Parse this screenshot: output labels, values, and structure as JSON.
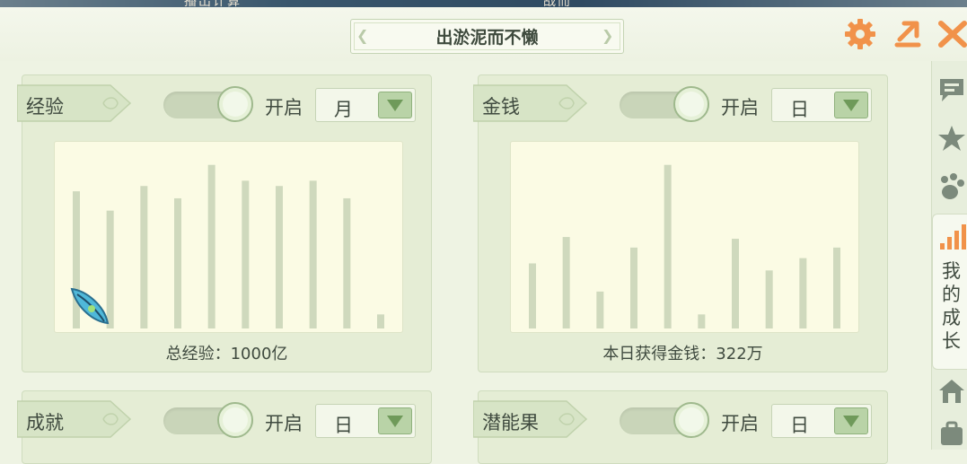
{
  "top_strip": {
    "left_text": "播出计算",
    "right_text": "战而"
  },
  "header": {
    "title": "出淤泥而不懒"
  },
  "header_icons": {
    "settings": "gear-icon",
    "export": "share-arrow-icon",
    "close": "close-icon"
  },
  "colors": {
    "accent_orange": "#f1924a",
    "bar": "#cfd9bd",
    "chart_bg": "#fbfbe4",
    "panel": "#e5edd5"
  },
  "panels": [
    {
      "label": "经验",
      "toggle_label": "开启",
      "select_value": "月",
      "total_text": "总经验：1000亿",
      "chart_data": {
        "type": "bar",
        "values": [
          78,
          67,
          81,
          74,
          93,
          84,
          81,
          84,
          74,
          8
        ],
        "ylim": [
          0,
          100
        ]
      }
    },
    {
      "label": "金钱",
      "toggle_label": "开启",
      "select_value": "日",
      "total_text": "本日获得金钱：322万",
      "chart_data": {
        "type": "bar",
        "values": [
          37,
          52,
          21,
          46,
          93,
          8,
          51,
          33,
          40,
          46
        ],
        "ylim": [
          0,
          100
        ]
      }
    },
    {
      "label": "成就",
      "toggle_label": "开启",
      "select_value": "日"
    },
    {
      "label": "潜能果",
      "toggle_label": "开启",
      "select_value": "日"
    }
  ],
  "sidebar": {
    "icons": [
      "chat-icon",
      "star-icon",
      "pawprint-icon",
      "signal-bars-icon",
      "house-icon",
      "bag-icon"
    ],
    "active_tab": "我的成长"
  }
}
